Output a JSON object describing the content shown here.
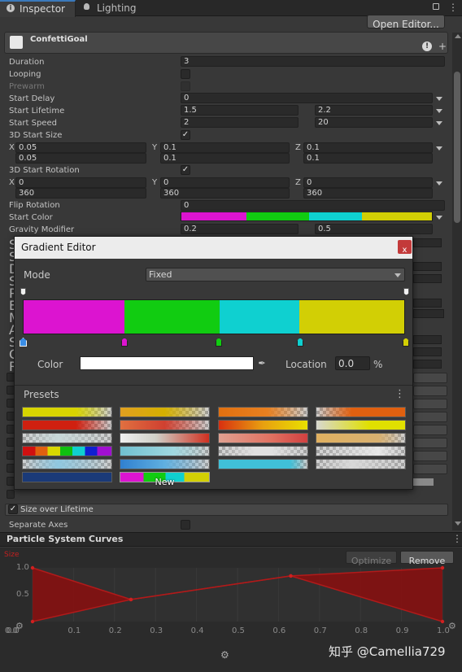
{
  "tabs": {
    "inspector": "Inspector",
    "lighting": "Lighting"
  },
  "open_editor": "Open Editor...",
  "component_title": "ConfettiGoal",
  "rows": {
    "duration": {
      "label": "Duration",
      "value": "3"
    },
    "looping": {
      "label": "Looping"
    },
    "prewarm": {
      "label": "Prewarm"
    },
    "start_delay": {
      "label": "Start Delay",
      "value": "0"
    },
    "start_lifetime": {
      "label": "Start Lifetime",
      "v1": "1.5",
      "v2": "2.2"
    },
    "start_speed": {
      "label": "Start Speed",
      "v1": "2",
      "v2": "20"
    },
    "size3d": {
      "label": "3D Start Size"
    },
    "size_xyz": {
      "x": "X",
      "y": "Y",
      "z": "Z",
      "x1": "0.05",
      "x2": "0.05",
      "y1": "0.1",
      "y2": "0.1",
      "z1": "0.1",
      "z2": "0.1"
    },
    "rot3d": {
      "label": "3D Start Rotation"
    },
    "rot_xyz": {
      "x": "X",
      "y": "Y",
      "z": "Z",
      "x1": "0",
      "x2": "360",
      "y1": "0",
      "y2": "360",
      "z1": "0",
      "z2": "360"
    },
    "flip": {
      "label": "Flip Rotation",
      "value": "0"
    },
    "start_color": {
      "label": "Start Color"
    },
    "gravity": {
      "label": "Gravity Modifier",
      "v1": "0.2",
      "v2": "0.5"
    }
  },
  "hidden_letters": [
    "S",
    "S",
    "D",
    "S",
    "P",
    "E",
    "M",
    "A",
    "S",
    "C",
    "R"
  ],
  "gradient_editor": {
    "title": "Gradient Editor",
    "close": "x",
    "mode_label": "Mode",
    "mode_value": "Fixed",
    "color_label": "Color",
    "location_label": "Location",
    "location_value": "0.0",
    "percent": "%",
    "presets_label": "Presets",
    "new_label": "New",
    "colors": {
      "magenta": "#dc14d0",
      "green": "#11cc11",
      "cyan": "#0fd0d0",
      "yellow": "#d2cf05"
    }
  },
  "size_over_lifetime": "Size over Lifetime",
  "separate_axes": "Separate Axes",
  "curves": {
    "title": "Particle System Curves",
    "optimize": "Optimize",
    "remove": "Remove",
    "series_label": "Size",
    "y_ticks": [
      "1.0",
      "0.5",
      "0.0"
    ],
    "x_ticks": [
      "0.0",
      "0.1",
      "0.2",
      "0.3",
      "0.4",
      "0.5",
      "0.6",
      "0.7",
      "0.8",
      "0.9",
      "1.0"
    ]
  },
  "chart_data": {
    "type": "area",
    "title": "",
    "xlabel": "",
    "ylabel": "Size",
    "xlim": [
      0,
      1
    ],
    "ylim": [
      0,
      1
    ],
    "series": [
      {
        "name": "Size",
        "x": [
          0,
          0.24,
          0.63,
          1.0
        ],
        "y": [
          1.0,
          0.41,
          0.85,
          0.0
        ]
      },
      {
        "x": [
          0,
          0.24,
          0.63,
          1.0
        ],
        "y": [
          0.0,
          0.41,
          0.85,
          1.0
        ]
      }
    ],
    "fill_color": "#8b0e0e",
    "line_color": "#b11a1a"
  },
  "watermark": "知乎 @Camellia729"
}
